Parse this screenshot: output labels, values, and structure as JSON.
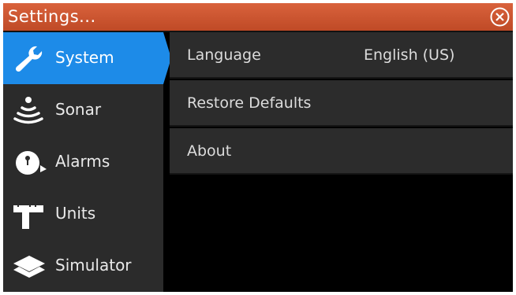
{
  "window": {
    "title": "Settings..."
  },
  "colors": {
    "titlebar": "#cc5530",
    "selected": "#1d8be8",
    "sidebar": "#2b2b2b",
    "row": "#2c2c2c"
  },
  "sidebar": {
    "items": [
      {
        "label": "System",
        "icon": "wrench-icon",
        "selected": true
      },
      {
        "label": "Sonar",
        "icon": "sonar-icon",
        "selected": false
      },
      {
        "label": "Alarms",
        "icon": "alarm-bell-icon",
        "selected": false
      },
      {
        "label": "Units",
        "icon": "units-ruler-icon",
        "selected": false
      },
      {
        "label": "Simulator",
        "icon": "layers-icon",
        "selected": false
      }
    ]
  },
  "system_panel": {
    "rows": [
      {
        "label": "Language",
        "value": "English (US)"
      },
      {
        "label": "Restore Defaults",
        "value": ""
      },
      {
        "label": "About",
        "value": ""
      }
    ]
  }
}
